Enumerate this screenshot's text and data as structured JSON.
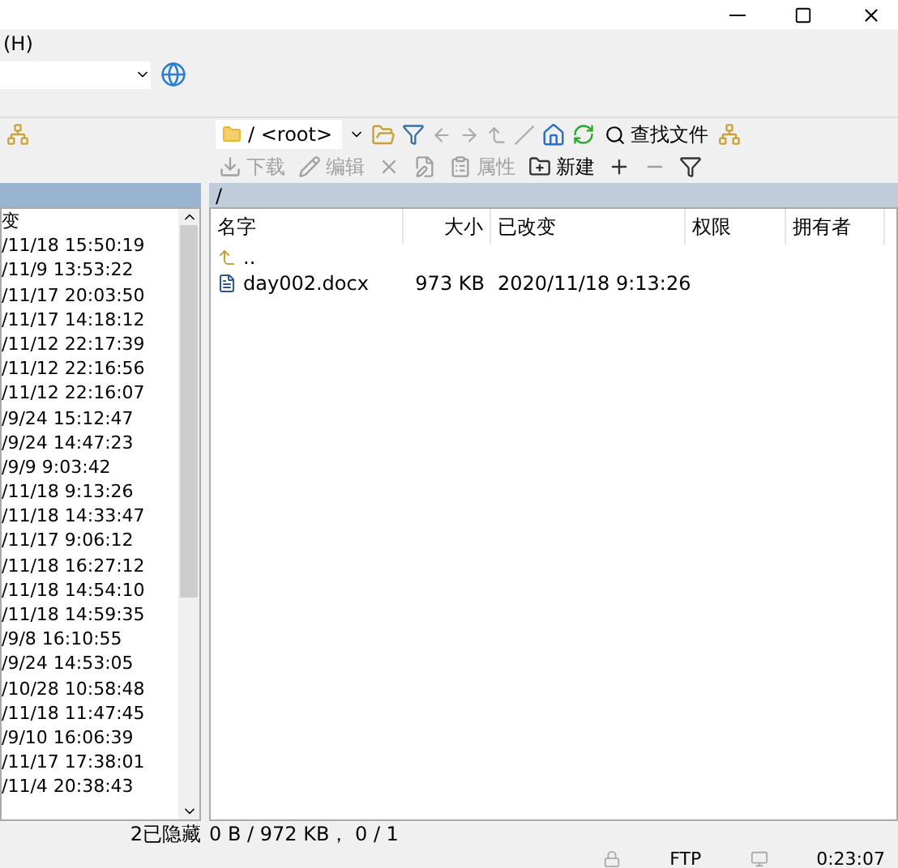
{
  "menu": [
    "(H)"
  ],
  "right_toolbar": {
    "path": "/ <root>",
    "find": "查找文件"
  },
  "right_actions": [
    {
      "kind": "text",
      "label": "下载",
      "disabled": true
    },
    {
      "kind": "text",
      "label": "编辑",
      "disabled": true
    },
    {
      "kind": "icon",
      "disabled": true
    },
    {
      "kind": "icon",
      "disabled": true
    },
    {
      "kind": "text",
      "label": "属性",
      "disabled": true
    },
    {
      "kind": "text",
      "label": "新建",
      "disabled": false
    },
    {
      "kind": "icon",
      "disabled": false
    },
    {
      "kind": "icon",
      "disabled": true
    },
    {
      "kind": "icon",
      "disabled": false
    }
  ],
  "left_panel": {
    "column": "变",
    "rows": [
      "/11/18  15:50:19",
      "/11/9  13:53:22",
      "/11/17  20:03:50",
      "/11/17  14:18:12",
      "/11/12  22:17:39",
      "/11/12  22:16:56",
      "/11/12  22:16:07",
      "/9/24  15:12:47",
      "/9/24  14:47:23",
      "/9/9  9:03:42",
      "/11/18  9:13:26",
      "/11/18  14:33:47",
      "/11/17  9:06:12",
      "/11/18  16:27:12",
      "/11/18  14:54:10",
      "/11/18  14:59:35",
      "/9/8  16:10:55",
      "/9/24  14:53:05",
      "/10/28  10:58:48",
      "/11/18  11:47:45",
      "/9/10  16:06:39",
      "/11/17  17:38:01",
      "/11/4  20:38:43"
    ],
    "status": "2已隐藏"
  },
  "right_panel": {
    "path": "/",
    "columns": [
      "名字",
      "大小",
      "已改变",
      "权限",
      "拥有者"
    ],
    "rows": [
      {
        "kind": "parent",
        "name": ".."
      },
      {
        "kind": "doc",
        "name": "day002.docx",
        "size": "973 KB",
        "changed": "2020/11/18 9:13:26"
      }
    ],
    "status": "0 B / 972 KB，  0 / 1"
  },
  "status_bar": {
    "protocol": "FTP",
    "time": "0:23:07"
  }
}
